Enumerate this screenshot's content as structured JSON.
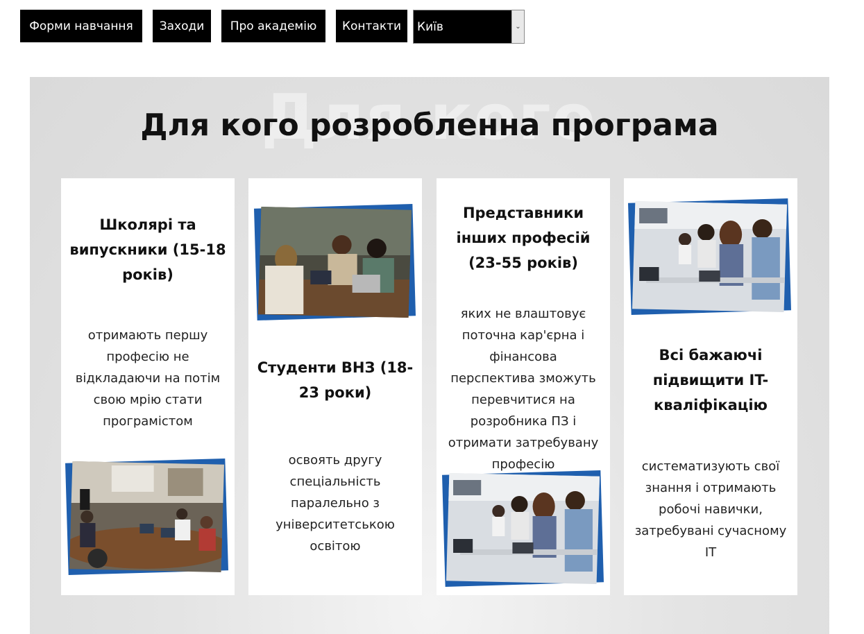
{
  "nav": {
    "forms": "Форми навчання",
    "events": "Заходи",
    "about": "Про академію",
    "contacts": "Контакти"
  },
  "city_select": {
    "value": "Київ"
  },
  "section": {
    "watermark": "Для кого",
    "title": "Для кого розробленна програма"
  },
  "cards": [
    {
      "title": "Школярі та випускники (15-18 років)",
      "description": "отримають першу професію не відкладаючи на потім свою мрію стати програмістом"
    },
    {
      "title": "Студенти ВНЗ (18-23 роки)",
      "description": "освоять другу спеціальність паралельно з університетською освітою"
    },
    {
      "title": "Представники інших професій (23-55 років)",
      "description": "яких не влаштовує поточна кар'єрна і фінансова перспектива зможуть перевчитися на розробника ПЗ і отримати затребувану професію"
    },
    {
      "title": "Всі бажаючі підвищити IT-кваліфікацію",
      "description": "систематизують свої знання і отримають робочі навички, затребувані сучасному IT"
    }
  ],
  "colors": {
    "nav_bg": "#000000",
    "nav_text": "#ffffff",
    "photo_frame": "#1f5fae"
  }
}
